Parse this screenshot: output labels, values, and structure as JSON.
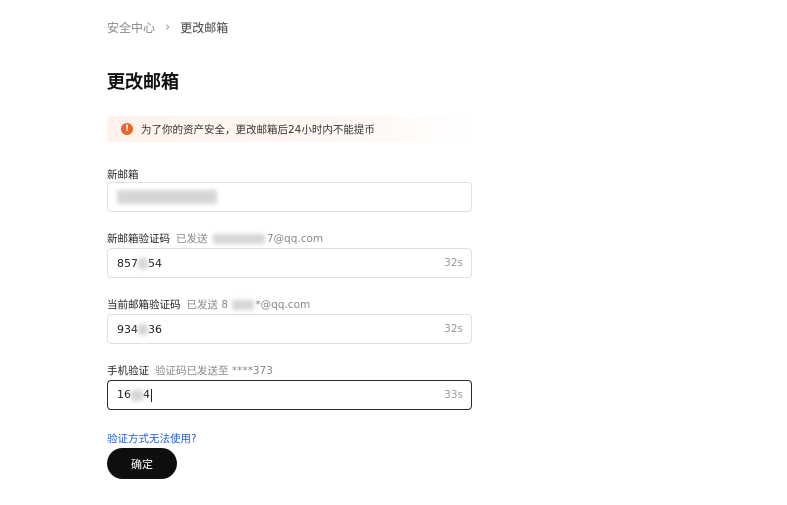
{
  "breadcrumb": {
    "parent": "安全中心",
    "separator": "›",
    "current": "更改邮箱"
  },
  "title": "更改邮箱",
  "notice": {
    "icon": "alert-icon",
    "text": "为了你的资产安全，更改邮箱后24小时内不能提币",
    "accent_color": "#e8662d"
  },
  "fields": {
    "new_email": {
      "label": "新邮箱",
      "value": ""
    },
    "new_email_code": {
      "label": "新邮箱验证码",
      "hint_prefix": "已发送",
      "hint_suffix": "7@qq.com",
      "value_start": "857",
      "value_end": "54",
      "countdown": "32s"
    },
    "current_email_code": {
      "label": "当前邮箱验证码",
      "hint_prefix": "已发送 8",
      "hint_suffix": "*@qq.com",
      "value_start": "934",
      "value_end": "36",
      "countdown": "32s"
    },
    "phone_code": {
      "label": "手机验证",
      "hint": "验证码已发送至 ****373",
      "value_start": "16",
      "value_end": "4",
      "countdown": "33s"
    }
  },
  "help_link": "验证方式无法使用?",
  "confirm_button": "确定"
}
